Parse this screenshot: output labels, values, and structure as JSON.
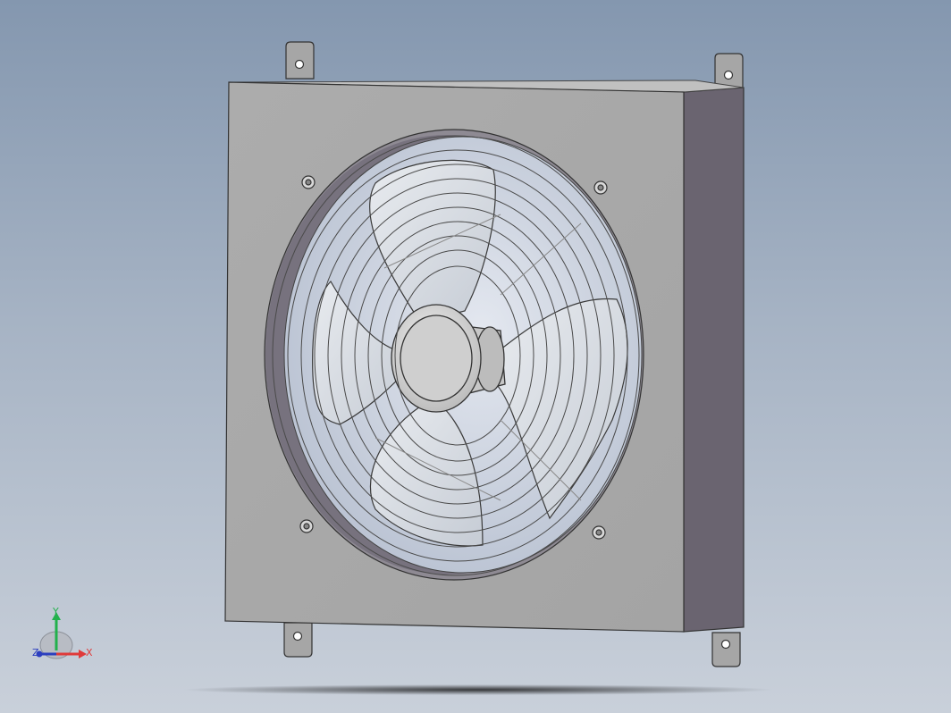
{
  "scene": {
    "object": "axial-fan-unit",
    "background_colors": [
      "#8497af",
      "#c9d0da"
    ],
    "housing_face_color": "#a9a9a9",
    "housing_side_color": "#6a6470",
    "blade_color": "#d9dde3",
    "guard_color": "#c4c6cb"
  },
  "triad": {
    "y_label": "Y",
    "x_label": "X",
    "z_label": "Z",
    "colors": {
      "x": "#e03a3a",
      "y": "#22b14c",
      "z": "#2c3fbf"
    }
  }
}
